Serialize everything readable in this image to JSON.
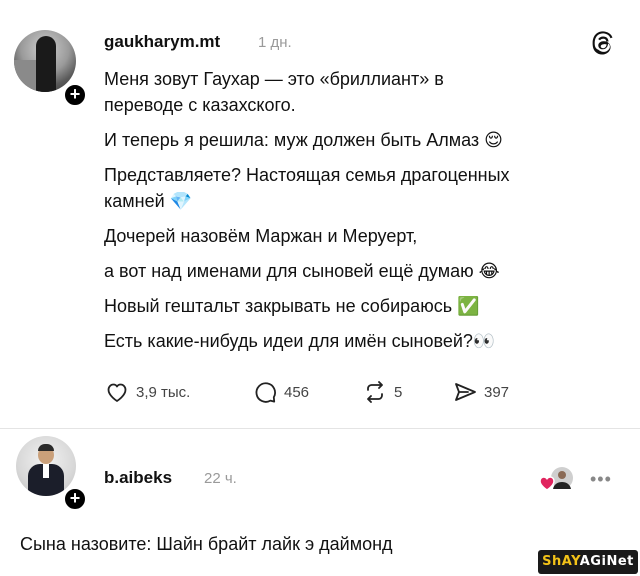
{
  "post": {
    "username": "gaukharym.mt",
    "time": "1 дн.",
    "lines": [
      "Меня зовут Гаухар — это «бриллиант» в",
      "переводе с казахского.",
      "И теперь я решила: муж должен быть Алмаз 😌",
      "Представляете? Настоящая семья драгоценных",
      "камней 💎",
      "Дочерей назовём Маржан и Меруерт,",
      "а вот над именами для сыновей ещё думаю 😂",
      "Новый гештальт закрывать не собираюсь ✅",
      "Есть какие-нибудь идеи для имён сыновей?👀"
    ],
    "likes": "3,9 тыс.",
    "comments": "456",
    "reposts": "5",
    "shares": "397"
  },
  "reply": {
    "username": "b.aibeks",
    "time": "22 ч.",
    "text": "Сына назовите: Шайн брайт лайк э даймонд"
  },
  "watermark": {
    "part1": "ShAY",
    "part2": "AGiNet"
  },
  "icons": {
    "threads": "threads-logo-icon",
    "like": "heart-icon",
    "comment": "comment-bubble-icon",
    "repost": "repost-icon",
    "share": "share-icon",
    "more": "more-dots-icon",
    "liked_by_author": "liked-by-author-icon"
  },
  "colors": {
    "text": "#111111",
    "muted": "#9a9a9a",
    "liked_heart": "#e0245e",
    "watermark_bg": "#1a1a1a",
    "watermark_fg": "#f3c318"
  }
}
